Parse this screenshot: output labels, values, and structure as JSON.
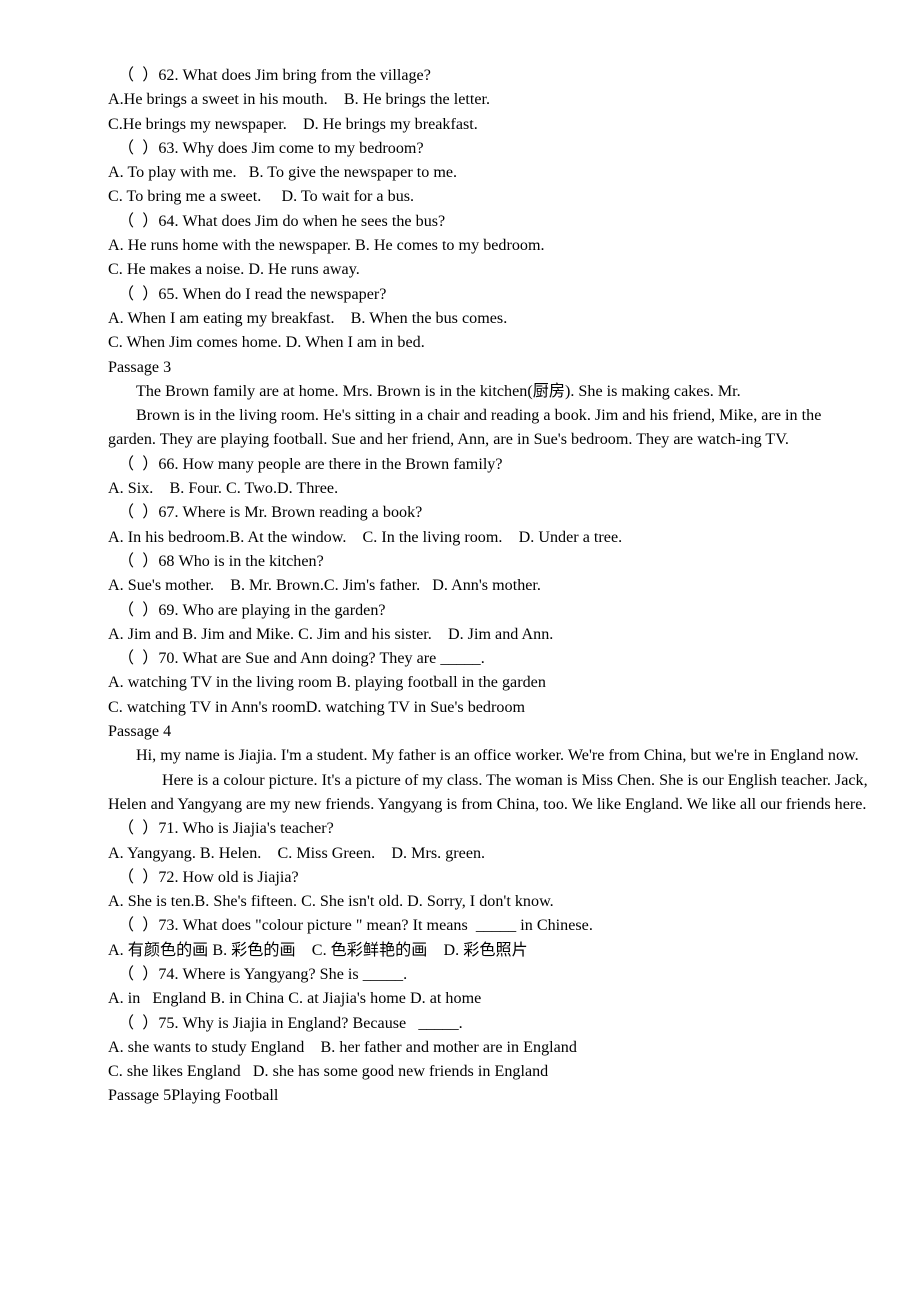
{
  "document": {
    "type": "english-reading-comprehension-worksheet",
    "background_color": "#ffffff",
    "text_color": "#000000"
  },
  "lines": [
    {
      "id": "l01",
      "style": "q",
      "text": "（  ）62. What does Jim bring from the village?"
    },
    {
      "id": "l02",
      "style": "opt",
      "text": "A.He brings a sweet in his mouth.    B. He brings the letter."
    },
    {
      "id": "l03",
      "style": "opt",
      "text": "C.He brings my newspaper.    D. He brings my breakfast."
    },
    {
      "id": "l04",
      "style": "q",
      "text": "（  ）63. Why does Jim come to my bedroom?"
    },
    {
      "id": "l05",
      "style": "opt",
      "text": "A. To play with me.   B. To give the newspaper to me."
    },
    {
      "id": "l06",
      "style": "opt",
      "text": "C. To bring me a sweet.     D. To wait for a bus."
    },
    {
      "id": "l07",
      "style": "q",
      "text": "（  ）64. What does Jim do when he sees the bus?"
    },
    {
      "id": "l08",
      "style": "opt",
      "text": "A. He runs home with the newspaper. B. He comes to my bedroom."
    },
    {
      "id": "l09",
      "style": "opt",
      "text": "C. He makes a noise. D. He runs away."
    },
    {
      "id": "l10",
      "style": "q",
      "text": "（  ）65. When do I read the newspaper?"
    },
    {
      "id": "l11",
      "style": "opt",
      "text": "A. When I am eating my breakfast.    B. When the bus comes."
    },
    {
      "id": "l12",
      "style": "opt",
      "text": "C. When Jim comes home. D. When I am in bed."
    },
    {
      "id": "l13",
      "style": "plain",
      "text": "Passage 3"
    },
    {
      "id": "l14",
      "style": "para",
      "text": "The Brown family are at home. Mrs. Brown is in the kitchen(厨房). She is making cakes. Mr."
    },
    {
      "id": "l15",
      "style": "para",
      "text": "Brown is in the living room. He's sitting in a chair and reading a book. Jim and his friend, Mike, are in the garden. They are playing football. Sue and her friend, Ann, are in Sue's bedroom. They are watch-ing TV."
    },
    {
      "id": "l16",
      "style": "q",
      "text": "（  ）66. How many people are there in the Brown family?"
    },
    {
      "id": "l17",
      "style": "opt",
      "text": "A. Six.    B. Four. C. Two.D. Three."
    },
    {
      "id": "l18",
      "style": "q",
      "text": "（  ）67. Where is Mr. Brown reading a book?"
    },
    {
      "id": "l19",
      "style": "opt",
      "text": "A. In his bedroom.B. At the window.    C. In the living room.    D. Under a tree."
    },
    {
      "id": "l20",
      "style": "q",
      "text": "（  ）68 Who is in the kitchen?"
    },
    {
      "id": "l21",
      "style": "opt",
      "text": "A. Sue's mother.    B. Mr. Brown.C. Jim's father.   D. Ann's mother."
    },
    {
      "id": "l22",
      "style": "q",
      "text": "（  ）69. Who are playing in the garden?"
    },
    {
      "id": "l23",
      "style": "opt",
      "text": "A. Jim and B. Jim and Mike. C. Jim and his sister.    D. Jim and Ann."
    },
    {
      "id": "l24",
      "style": "q",
      "text": "（  ）70. What are Sue and Ann doing? They are _____."
    },
    {
      "id": "l25",
      "style": "opt",
      "text": "A. watching TV in the living room B. playing football in the garden"
    },
    {
      "id": "l26",
      "style": "opt",
      "text": "C. watching TV in Ann's roomD. watching TV in Sue's bedroom"
    },
    {
      "id": "l27",
      "style": "plain",
      "text": "Passage 4"
    },
    {
      "id": "l28",
      "style": "para",
      "text": "Hi, my name is Jiajia. I'm a student. My father is an office worker. We're from China, but we're in England now."
    },
    {
      "id": "l29",
      "style": "para-deep",
      "text": "Here is a colour picture. It's a picture of my class. The woman is Miss Chen. She is our English teacher. Jack, Helen and Yangyang are my new friends. Yangyang is from China, too. We like England. We like all our friends here."
    },
    {
      "id": "l30",
      "style": "q",
      "text": "（  ）71. Who is Jiajia's teacher?"
    },
    {
      "id": "l31",
      "style": "opt",
      "text": "A. Yangyang. B. Helen.    C. Miss Green.    D. Mrs. green."
    },
    {
      "id": "l32",
      "style": "q",
      "text": "（  ）72. How old is Jiajia?"
    },
    {
      "id": "l33",
      "style": "opt",
      "text": "A. She is ten.B. She's fifteen. C. She isn't old. D. Sorry, I don't know."
    },
    {
      "id": "l34",
      "style": "q",
      "text": "（  ）73. What does \"colour picture \" mean? It means  _____ in Chinese."
    },
    {
      "id": "l35",
      "style": "opt",
      "text": "A. 有颜色的画 B. 彩色的画    C. 色彩鲜艳的画    D. 彩色照片"
    },
    {
      "id": "l36",
      "style": "q",
      "text": "（  ）74. Where is Yangyang? She is _____."
    },
    {
      "id": "l37",
      "style": "opt",
      "text": "A. in   England B. in China C. at Jiajia's home D. at home"
    },
    {
      "id": "l38",
      "style": "q",
      "text": "（  ）75. Why is Jiajia in England? Because   _____."
    },
    {
      "id": "l39",
      "style": "opt",
      "text": "A. she wants to study England    B. her father and mother are in England"
    },
    {
      "id": "l40",
      "style": "opt",
      "text": "C. she likes England   D. she has some good new friends in England"
    },
    {
      "id": "l41",
      "style": "plain",
      "text": "Passage 5Playing Football"
    }
  ]
}
